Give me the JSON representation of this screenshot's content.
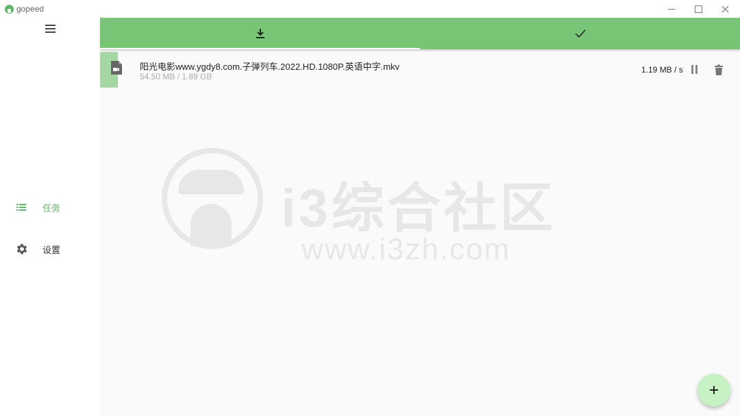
{
  "window": {
    "app_title": "gopeed"
  },
  "sidebar": {
    "items": [
      {
        "label": "任务",
        "icon": "list-icon",
        "active": true
      },
      {
        "label": "设置",
        "icon": "gear-icon",
        "active": false
      }
    ]
  },
  "tabs": [
    {
      "icon": "download-icon",
      "selected": true
    },
    {
      "icon": "check-icon",
      "selected": false
    }
  ],
  "tasks": [
    {
      "name": "阳光电影www.ygdy8.com.子弹列车.2022.HD.1080P.英语中字.mkv",
      "size": "54.50 MB / 1.89 GB",
      "speed": "1.19 MB / s",
      "progress": 0.028,
      "file_icon": "video-file-icon"
    }
  ],
  "watermark": {
    "brand": "i3综合社区",
    "url": "www.i3zh.com"
  },
  "colors": {
    "accent": "#79c576",
    "accent_text": "#5fb866",
    "progress": "#a4d7a2",
    "fab": "#c7f2c4"
  }
}
